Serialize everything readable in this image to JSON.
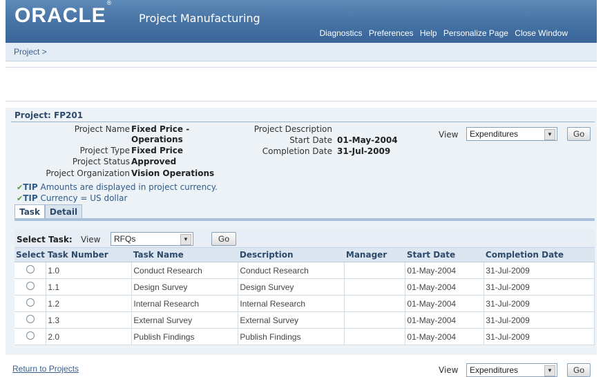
{
  "header": {
    "logo": "ORACLE",
    "app_name": "Project Manufacturing",
    "links": [
      "Diagnostics",
      "Preferences",
      "Help",
      "Personalize Page",
      "Close Window"
    ]
  },
  "breadcrumb": "Project >",
  "project": {
    "title": "Project: FP201",
    "fields": {
      "name_label": "Project Name",
      "name_value_1": "Fixed Price -",
      "name_value_2": "Operations",
      "type_label": "Project Type",
      "type_value": "Fixed Price",
      "status_label": "Project Status",
      "status_value": "Approved",
      "org_label": "Project Organization",
      "org_value": "Vision Operations",
      "desc_label": "Project Description",
      "start_label": "Start Date",
      "start_value": "01-May-2004",
      "completion_label": "Completion Date",
      "completion_value": "31-Jul-2009"
    },
    "view_label": "View",
    "view_value": "Expenditures",
    "go": "Go",
    "tips": [
      {
        "prefix": "TIP",
        "text": "Amounts are displayed in project currency."
      },
      {
        "prefix": "TIP",
        "text": "Currency = US dollar"
      }
    ]
  },
  "tabs": [
    "Task",
    "Detail"
  ],
  "select_task": {
    "label": "Select Task:",
    "view_label": "View",
    "view_value": "RFQs",
    "go": "Go"
  },
  "table": {
    "headers": [
      "Select",
      "Task Number",
      "Task Name",
      "Description",
      "Manager",
      "Start Date",
      "Completion Date"
    ],
    "rows": [
      [
        "1.0",
        "Conduct Research",
        "Conduct Research",
        "",
        "01-May-2004",
        "31-Jul-2009"
      ],
      [
        "1.1",
        "Design Survey",
        "Design Survey",
        "",
        "01-May-2004",
        "31-Jul-2009"
      ],
      [
        "1.2",
        "Internal Research",
        "Internal Research",
        "",
        "01-May-2004",
        "31-Jul-2009"
      ],
      [
        "1.3",
        "External Survey",
        "External Survey",
        "",
        "01-May-2004",
        "31-Jul-2009"
      ],
      [
        "2.0",
        "Publish Findings",
        "Publish Findings",
        "",
        "01-May-2004",
        "31-Jul-2009"
      ]
    ]
  },
  "footer": {
    "return_link": "Return to Projects",
    "view_label": "View",
    "view_value": "Expenditures",
    "go": "Go"
  }
}
